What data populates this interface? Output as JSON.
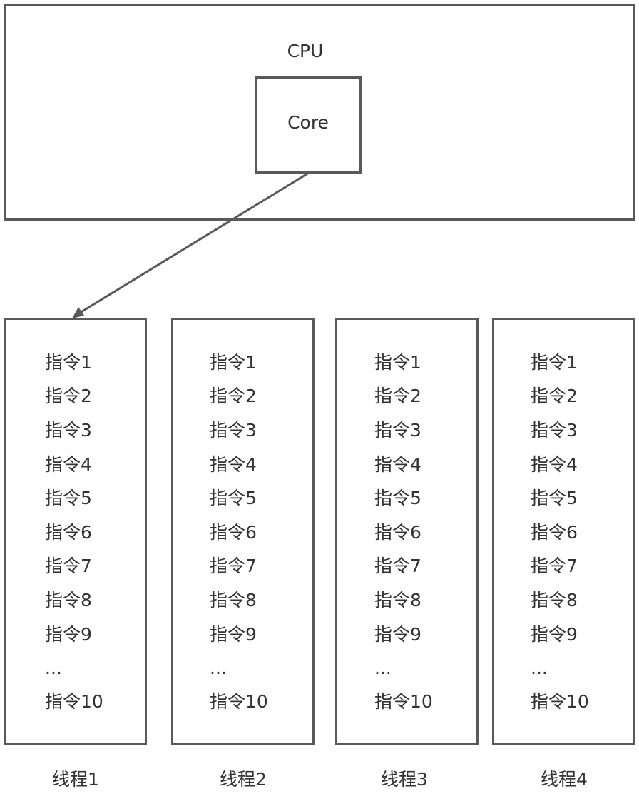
{
  "cpu": {
    "label": "CPU",
    "core_label": "Core"
  },
  "threads": [
    {
      "name": "线程1",
      "instructions": [
        "指令1",
        "指令2",
        "指令3",
        "指令4",
        "指令5",
        "指令6",
        "指令7",
        "指令8",
        "指令9",
        "...",
        "指令10"
      ]
    },
    {
      "name": "线程2",
      "instructions": [
        "指令1",
        "指令2",
        "指令3",
        "指令4",
        "指令5",
        "指令6",
        "指令7",
        "指令8",
        "指令9",
        "...",
        "指令10"
      ]
    },
    {
      "name": "线程3",
      "instructions": [
        "指令1",
        "指令2",
        "指令3",
        "指令4",
        "指令5",
        "指令6",
        "指令7",
        "指令8",
        "指令9",
        "...",
        "指令10"
      ]
    },
    {
      "name": "线程4",
      "instructions": [
        "指令1",
        "指令2",
        "指令3",
        "指令4",
        "指令5",
        "指令6",
        "指令7",
        "指令8",
        "指令9",
        "...",
        "指令10"
      ]
    }
  ],
  "connection": {
    "from": "Core",
    "to": "线程1"
  },
  "colors": {
    "stroke": "#595959",
    "text": "#333333"
  }
}
